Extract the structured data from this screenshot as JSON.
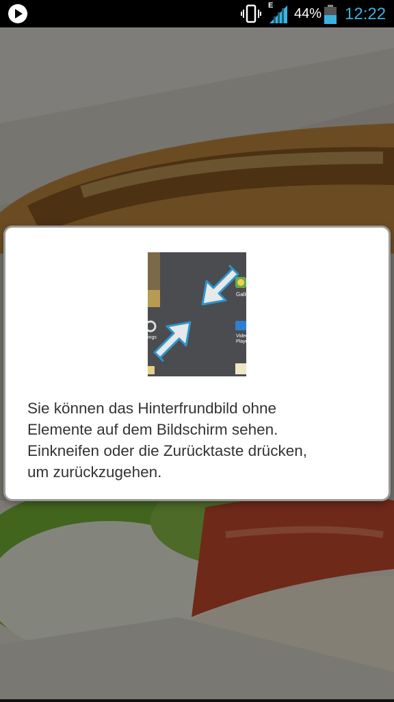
{
  "status_bar": {
    "network_type": "E",
    "battery_percent": "44%",
    "time": "12:22"
  },
  "dialog": {
    "message": "Sie können das Hinterfrundbild ohne\nElemente auf dem Bildschirm sehen.\nEinkneifen oder die Zurücktaste drücken,\num zurückzugehen.",
    "illustration": {
      "app_labels": [
        "Galler",
        "ings",
        "Video\nPlayer"
      ]
    }
  },
  "colors": {
    "time": "#39b3e0",
    "battery": "#39b3e0",
    "signal": "#39b3e0"
  }
}
